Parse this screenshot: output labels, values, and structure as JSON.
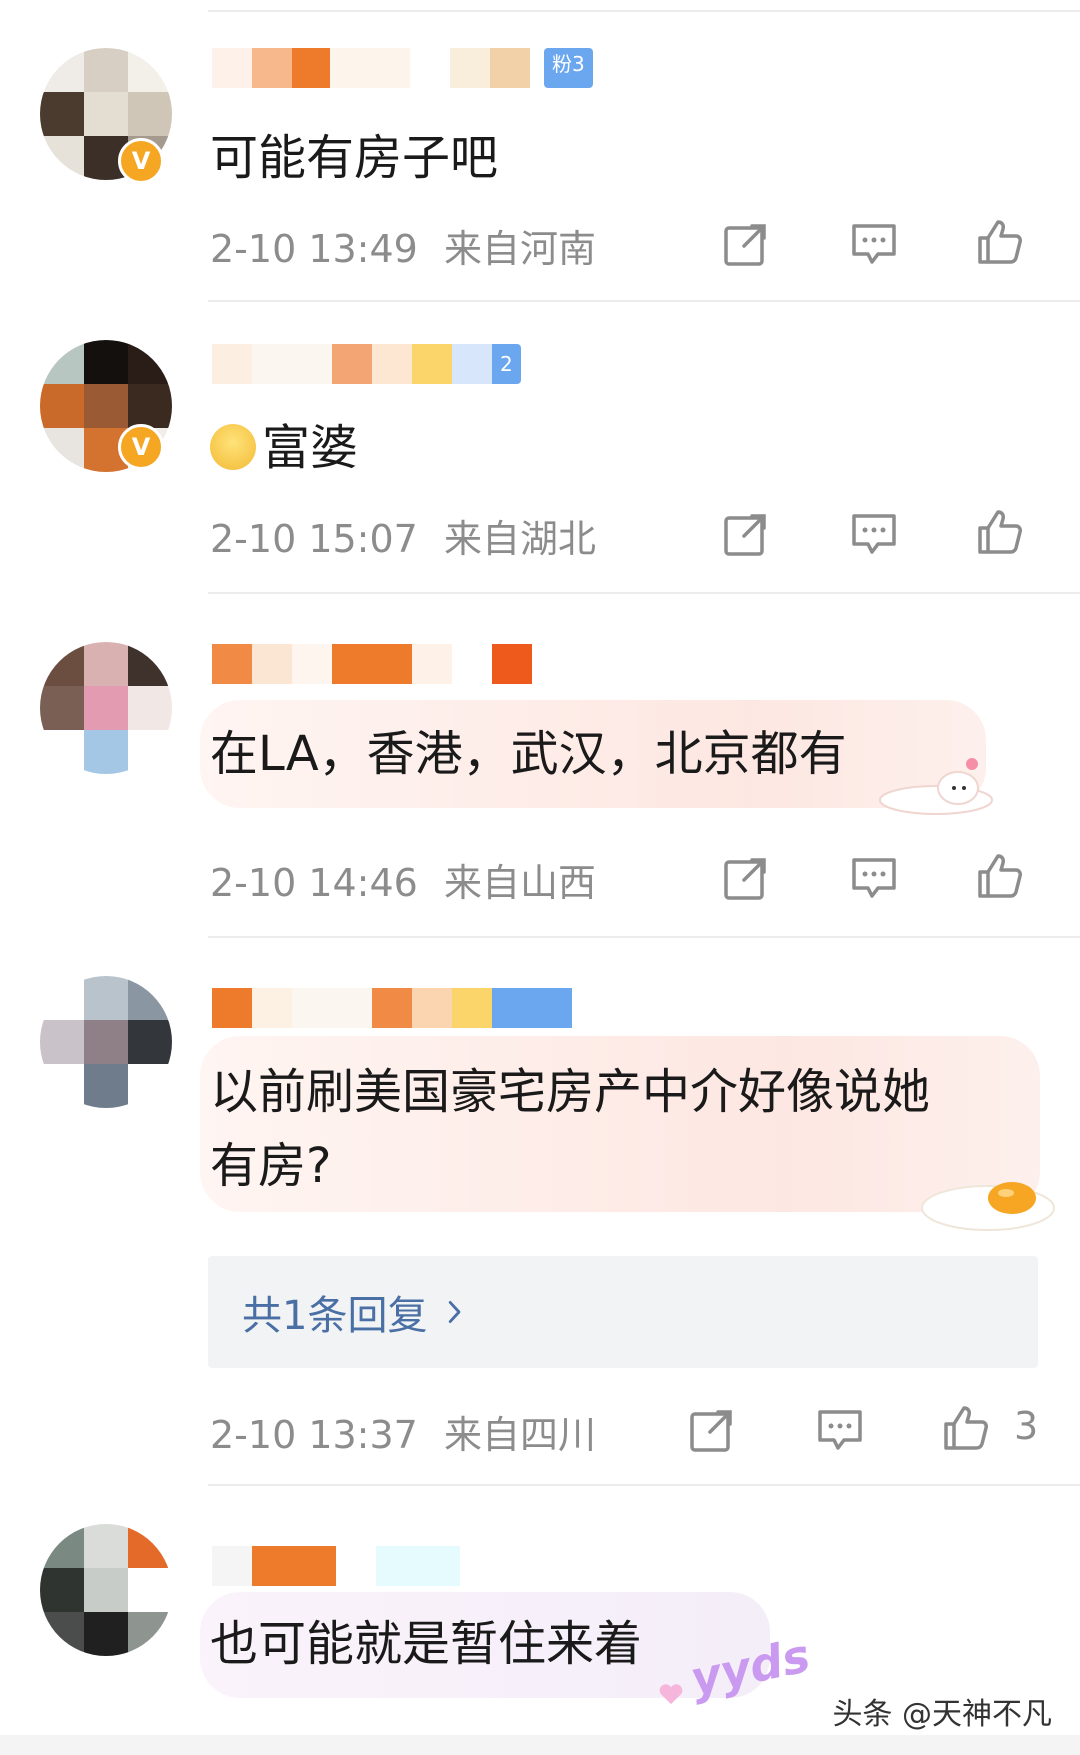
{
  "comments": [
    {
      "name_badge": "粉3",
      "text": "可能有房子吧",
      "time": "2-10 13:49",
      "location": "来自河南"
    },
    {
      "name_badge": "2",
      "emoji": "pleading-face",
      "text": "富婆",
      "time": "2-10 15:07",
      "location": "来自湖北"
    },
    {
      "text": "在LA，香港，武汉，北京都有",
      "time": "2-10 14:46",
      "location": "来自山西"
    },
    {
      "text_line1": "以前刷美国豪宅房产中介好像说她",
      "text_line2": "有房?",
      "reply_link": "共1条回复",
      "time": "2-10 13:37",
      "location": "来自四川",
      "like_count": "3"
    },
    {
      "text": "也可能就是暂住来着",
      "sticker_text": "yyds"
    }
  ],
  "icons": {
    "share": "share-icon",
    "comment": "comment-icon",
    "like": "thumbs-up-icon",
    "reply_arrow": "chevron-right-icon",
    "verified": "verified-v-icon"
  },
  "colors": {
    "meta_gray": "#8c8c8c",
    "link_blue": "#4a6fa5",
    "verified_gold": "#f5a623",
    "fan_badge_blue": "#6aa7ee"
  },
  "watermark": "头条 @天神不凡"
}
